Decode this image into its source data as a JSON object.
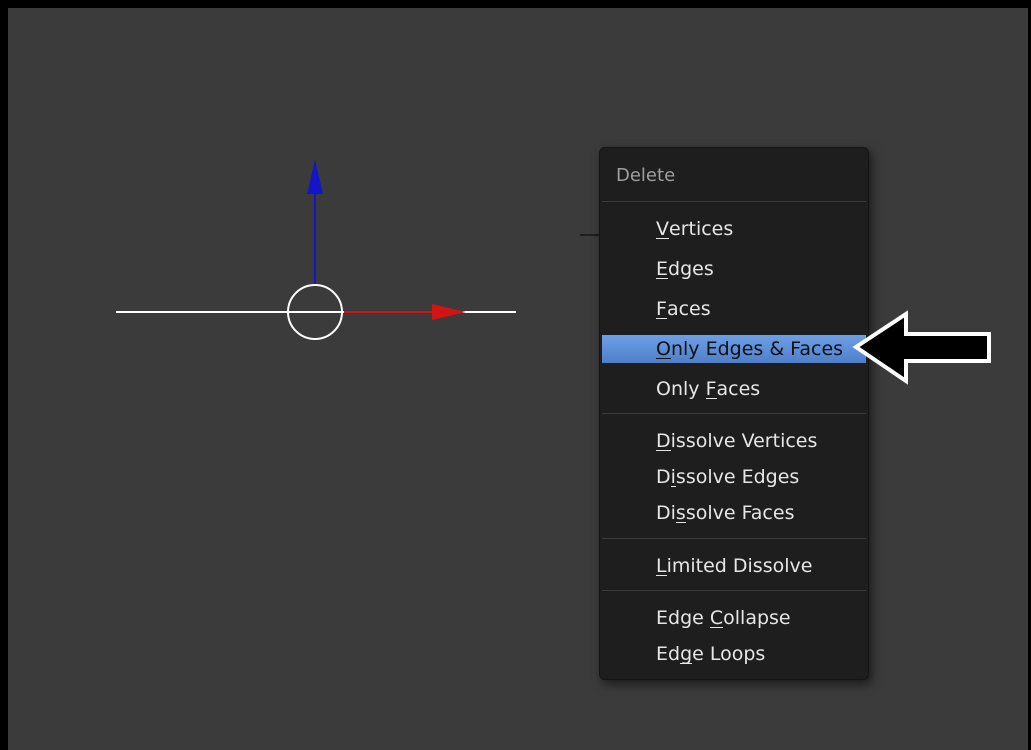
{
  "menu": {
    "title": "Delete",
    "groups": [
      {
        "items": [
          {
            "pre": "",
            "accel": "V",
            "post": "ertices"
          },
          {
            "pre": "",
            "accel": "E",
            "post": "dges"
          },
          {
            "pre": "",
            "accel": "F",
            "post": "aces"
          },
          {
            "pre": "",
            "accel": "O",
            "post": "nly Edges & Faces"
          },
          {
            "pre": "Only ",
            "accel": "F",
            "post": "aces"
          }
        ]
      },
      {
        "items": [
          {
            "pre": "",
            "accel": "D",
            "post": "issolve Vertices"
          },
          {
            "pre": "D",
            "accel": "i",
            "post": "ssolve Edges"
          },
          {
            "pre": "Di",
            "accel": "s",
            "post": "solve Faces"
          }
        ]
      },
      {
        "items": [
          {
            "pre": "",
            "accel": "L",
            "post": "imited Dissolve"
          }
        ]
      },
      {
        "items": [
          {
            "pre": "Edge ",
            "accel": "C",
            "post": "ollapse"
          },
          {
            "pre": "Ed",
            "accel": "g",
            "post": "e Loops"
          }
        ]
      }
    ],
    "active_item": "Only Edges & Faces"
  },
  "gizmo": {
    "icons": [
      "z-axis-arrow-icon",
      "x-axis-arrow-icon",
      "origin-circle-icon"
    ],
    "colors": {
      "z_axis": "#1414c8",
      "x_axis": "#d21414",
      "line": "#ffffff"
    }
  },
  "annotation": {
    "icon": "pointer-arrow-icon",
    "color": "#000000"
  },
  "colors": {
    "background": "#3b3b3b",
    "menu_bg": "#1e1e1e",
    "highlight": "#5b8fda"
  }
}
